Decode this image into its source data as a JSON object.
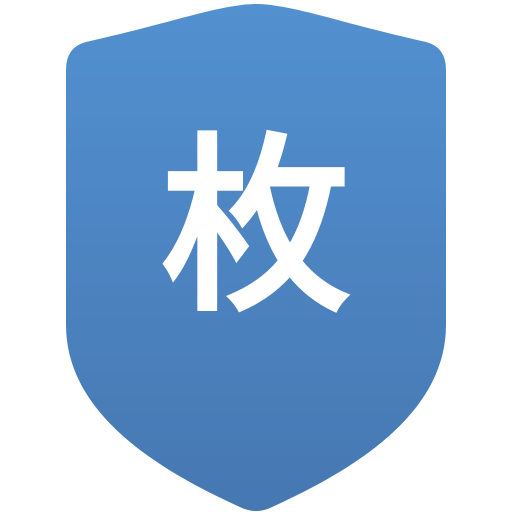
{
  "badge": {
    "glyph": "枚",
    "icon": "shield-icon",
    "colors": {
      "top": "#5290D0",
      "bottom": "#4678B2",
      "glyph": "#FFFFFF"
    }
  }
}
